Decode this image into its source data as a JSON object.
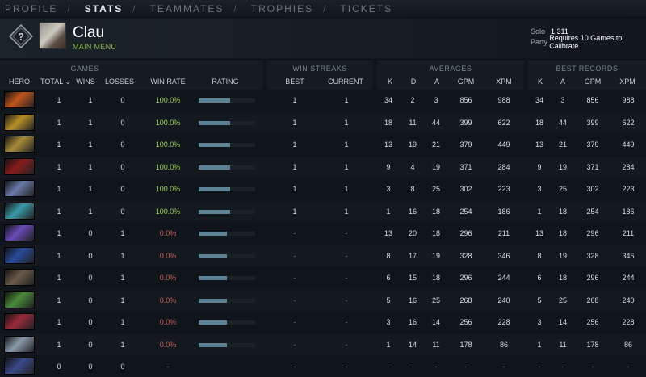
{
  "nav": {
    "items": [
      "PROFILE",
      "STATS",
      "TEAMMATES",
      "TROPHIES",
      "TICKETS"
    ],
    "separator": "/"
  },
  "player": {
    "name": "Clau",
    "status": "MAIN MENU",
    "badge_glyph": "?",
    "mmr": {
      "solo_label": "Solo",
      "solo_value": "1,311",
      "party_label": "Party",
      "party_value": "Requires 10 Games to Calibrate"
    }
  },
  "groups": {
    "games": "GAMES",
    "win_streaks": "WIN STREAKS",
    "averages": "AVERAGES",
    "best_records": "BEST RECORDS"
  },
  "columns": {
    "hero": "HERO",
    "total": "TOTAL",
    "sort_arrow": "⌄",
    "wins": "WINS",
    "losses": "LOSSES",
    "win_rate": "WIN RATE",
    "rating": "RATING",
    "best": "BEST",
    "current": "CURRENT",
    "k": "K",
    "d": "D",
    "a": "A",
    "gpm": "GPM",
    "xpm": "XPM",
    "best_k": "K",
    "best_a": "A",
    "best_gpm": "GPM",
    "best_xpm": "XPM"
  },
  "rows": [
    {
      "hero_icon": "hero-icon-1",
      "hero_color": "#c2541c",
      "total": "1",
      "wins": "1",
      "losses": "0",
      "win_rate": "100.0%",
      "rating": 0.55,
      "best": "1",
      "current": "1",
      "k": "34",
      "d": "2",
      "a": "3",
      "gpm": "856",
      "xpm": "988",
      "bk": "34",
      "ba": "3",
      "bgpm": "856",
      "bxpm": "988"
    },
    {
      "hero_icon": "hero-icon-2",
      "hero_color": "#b8902a",
      "total": "1",
      "wins": "1",
      "losses": "0",
      "win_rate": "100.0%",
      "rating": 0.55,
      "best": "1",
      "current": "1",
      "k": "18",
      "d": "11",
      "a": "44",
      "gpm": "399",
      "xpm": "622",
      "bk": "18",
      "ba": "44",
      "bgpm": "399",
      "bxpm": "622"
    },
    {
      "hero_icon": "hero-icon-3",
      "hero_color": "#a88a3a",
      "total": "1",
      "wins": "1",
      "losses": "0",
      "win_rate": "100.0%",
      "rating": 0.55,
      "best": "1",
      "current": "1",
      "k": "13",
      "d": "19",
      "a": "21",
      "gpm": "379",
      "xpm": "449",
      "bk": "13",
      "ba": "21",
      "bgpm": "379",
      "bxpm": "449"
    },
    {
      "hero_icon": "hero-icon-4",
      "hero_color": "#8a1c1c",
      "total": "1",
      "wins": "1",
      "losses": "0",
      "win_rate": "100.0%",
      "rating": 0.55,
      "best": "1",
      "current": "1",
      "k": "9",
      "d": "4",
      "a": "19",
      "gpm": "371",
      "xpm": "284",
      "bk": "9",
      "ba": "19",
      "bgpm": "371",
      "bxpm": "284"
    },
    {
      "hero_icon": "hero-icon-5",
      "hero_color": "#6a7aa8",
      "total": "1",
      "wins": "1",
      "losses": "0",
      "win_rate": "100.0%",
      "rating": 0.55,
      "best": "1",
      "current": "1",
      "k": "3",
      "d": "8",
      "a": "25",
      "gpm": "302",
      "xpm": "223",
      "bk": "3",
      "ba": "25",
      "bgpm": "302",
      "bxpm": "223"
    },
    {
      "hero_icon": "hero-icon-6",
      "hero_color": "#3a9aa8",
      "total": "1",
      "wins": "1",
      "losses": "0",
      "win_rate": "100.0%",
      "rating": 0.55,
      "best": "1",
      "current": "1",
      "k": "1",
      "d": "16",
      "a": "18",
      "gpm": "254",
      "xpm": "186",
      "bk": "1",
      "ba": "18",
      "bgpm": "254",
      "bxpm": "186"
    },
    {
      "hero_icon": "hero-icon-7",
      "hero_color": "#6a4ab8",
      "total": "1",
      "wins": "0",
      "losses": "1",
      "win_rate": "0.0%",
      "rating": 0.5,
      "best": "-",
      "current": "-",
      "k": "13",
      "d": "20",
      "a": "18",
      "gpm": "296",
      "xpm": "211",
      "bk": "13",
      "ba": "18",
      "bgpm": "296",
      "bxpm": "211"
    },
    {
      "hero_icon": "hero-icon-8",
      "hero_color": "#2a4a9a",
      "total": "1",
      "wins": "0",
      "losses": "1",
      "win_rate": "0.0%",
      "rating": 0.5,
      "best": "-",
      "current": "-",
      "k": "8",
      "d": "17",
      "a": "19",
      "gpm": "328",
      "xpm": "346",
      "bk": "8",
      "ba": "19",
      "bgpm": "328",
      "bxpm": "346"
    },
    {
      "hero_icon": "hero-icon-9",
      "hero_color": "#6a5a4a",
      "total": "1",
      "wins": "0",
      "losses": "1",
      "win_rate": "0.0%",
      "rating": 0.5,
      "best": "-",
      "current": "-",
      "k": "6",
      "d": "15",
      "a": "18",
      "gpm": "296",
      "xpm": "244",
      "bk": "6",
      "ba": "18",
      "bgpm": "296",
      "bxpm": "244"
    },
    {
      "hero_icon": "hero-icon-10",
      "hero_color": "#4a8a3a",
      "total": "1",
      "wins": "0",
      "losses": "1",
      "win_rate": "0.0%",
      "rating": 0.5,
      "best": "-",
      "current": "-",
      "k": "5",
      "d": "16",
      "a": "25",
      "gpm": "268",
      "xpm": "240",
      "bk": "5",
      "ba": "25",
      "bgpm": "268",
      "bxpm": "240"
    },
    {
      "hero_icon": "hero-icon-11",
      "hero_color": "#9a2a3a",
      "total": "1",
      "wins": "0",
      "losses": "1",
      "win_rate": "0.0%",
      "rating": 0.5,
      "best": "-",
      "current": "-",
      "k": "3",
      "d": "16",
      "a": "14",
      "gpm": "256",
      "xpm": "228",
      "bk": "3",
      "ba": "14",
      "bgpm": "256",
      "bxpm": "228"
    },
    {
      "hero_icon": "hero-icon-12",
      "hero_color": "#8a9aaa",
      "total": "1",
      "wins": "0",
      "losses": "1",
      "win_rate": "0.0%",
      "rating": 0.5,
      "best": "-",
      "current": "-",
      "k": "1",
      "d": "14",
      "a": "11",
      "gpm": "178",
      "xpm": "86",
      "bk": "1",
      "ba": "11",
      "bgpm": "178",
      "bxpm": "86"
    },
    {
      "hero_icon": "hero-icon-13",
      "hero_color": "#3a4a8a",
      "total": "0",
      "wins": "0",
      "losses": "0",
      "win_rate": "-",
      "rating": 0,
      "best": "-",
      "current": "-",
      "k": "-",
      "d": "-",
      "a": "-",
      "gpm": "-",
      "xpm": "-",
      "bk": "-",
      "ba": "-",
      "bgpm": "-",
      "bxpm": "-"
    }
  ]
}
